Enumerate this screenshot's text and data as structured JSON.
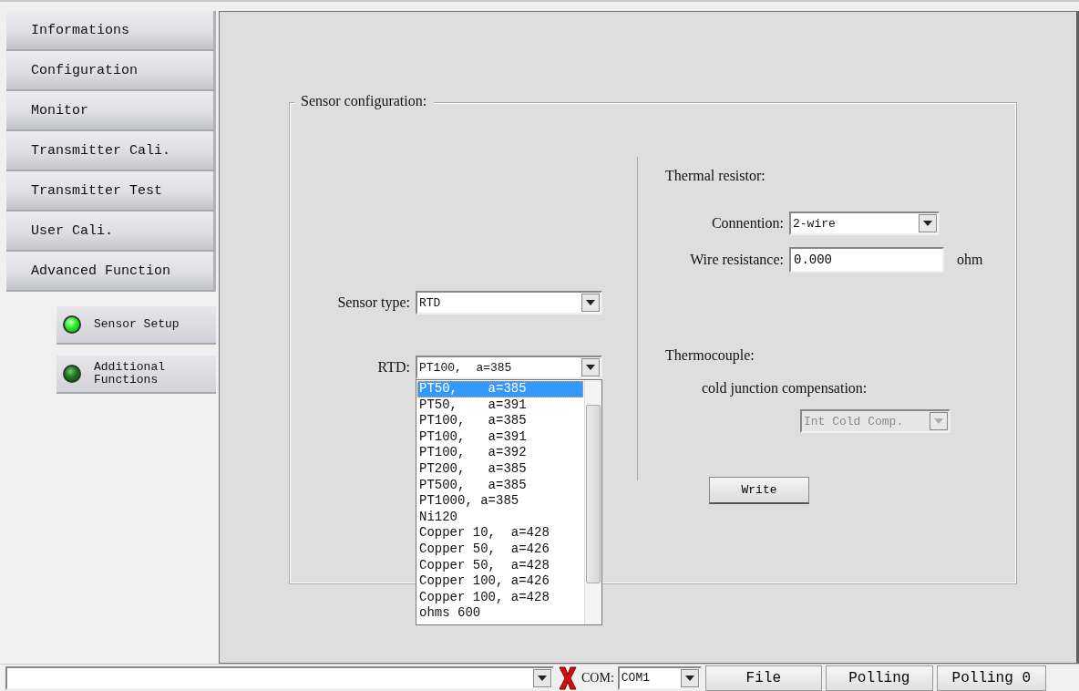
{
  "sidebar": {
    "items": [
      {
        "label": "Informations"
      },
      {
        "label": "Configuration"
      },
      {
        "label": "Monitor"
      },
      {
        "label": "Transmitter Cali."
      },
      {
        "label": "Transmitter Test"
      },
      {
        "label": "User Cali."
      },
      {
        "label": "Advanced Function"
      }
    ],
    "sub_items": [
      {
        "label": "Sensor Setup",
        "on": true
      },
      {
        "label": "Additional Functions",
        "on": false
      }
    ]
  },
  "sensor_configuration": {
    "title": "Sensor configuration:",
    "sensor_type": {
      "label": "Sensor type:",
      "value": "RTD"
    },
    "rtd": {
      "label": "RTD:",
      "value": "PT100,  a=385",
      "expanded": true,
      "options": [
        {
          "label": "PT50,    a=385",
          "selected": true
        },
        {
          "label": "PT50,    a=391",
          "selected": false
        },
        {
          "label": "PT100,   a=385",
          "selected": false
        },
        {
          "label": "PT100,   a=391",
          "selected": false
        },
        {
          "label": "PT100,   a=392",
          "selected": false
        },
        {
          "label": "PT200,   a=385",
          "selected": false
        },
        {
          "label": "PT500,   a=385",
          "selected": false
        },
        {
          "label": "PT1000, a=385",
          "selected": false
        },
        {
          "label": "Ni120",
          "selected": false
        },
        {
          "label": "Copper 10,  a=428",
          "selected": false
        },
        {
          "label": "Copper 50,  a=426",
          "selected": false
        },
        {
          "label": "Copper 50,  a=428",
          "selected": false
        },
        {
          "label": "Copper 100, a=426",
          "selected": false
        },
        {
          "label": "Copper 100, a=428",
          "selected": false
        },
        {
          "label": "ohms 600",
          "selected": false
        }
      ]
    },
    "thermal_resistor": {
      "title": "Thermal resistor:",
      "connection_label": "Connention:",
      "connection": "2-wire",
      "wire_resistance_label": "Wire resistance:",
      "wire_resistance": "0.000",
      "unit": "ohm"
    },
    "thermocouple": {
      "title": "Thermocouple:",
      "cjc_label": "cold junction compensation:",
      "cjc": "Int Cold Comp.",
      "cjc_disabled": true
    },
    "write_button": "Write"
  },
  "status_bar": {
    "com_label": "COM:",
    "com_port": "COM1",
    "buttons": [
      "File",
      "Polling",
      "Polling 0"
    ]
  }
}
